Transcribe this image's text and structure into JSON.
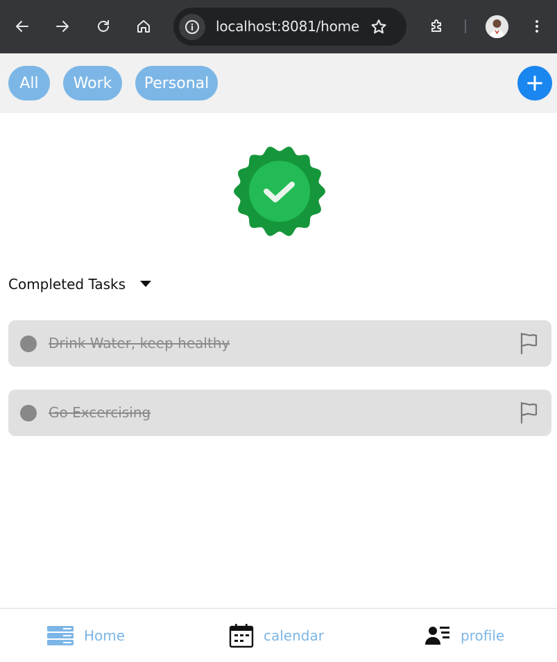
{
  "browser": {
    "url": "localhost:8081/home"
  },
  "filters": {
    "chips": [
      "All",
      "Work",
      "Personal"
    ]
  },
  "section": {
    "title": "Completed Tasks"
  },
  "tasks": [
    {
      "title": "Drink Water, keep healthy"
    },
    {
      "title": "Go Excercising"
    }
  ],
  "nav": {
    "items": [
      {
        "label": "Home",
        "icon": "home-list-icon"
      },
      {
        "label": "calendar",
        "icon": "calendar-icon"
      },
      {
        "label": "profile",
        "icon": "profile-list-icon"
      }
    ]
  },
  "colors": {
    "chip": "#7cb6e6",
    "add_button": "#1a86f0",
    "badge_outer": "#16963b",
    "badge_inner": "#22bb55",
    "task_card": "#e0e0e0",
    "nav_label": "#7cb6e6"
  }
}
